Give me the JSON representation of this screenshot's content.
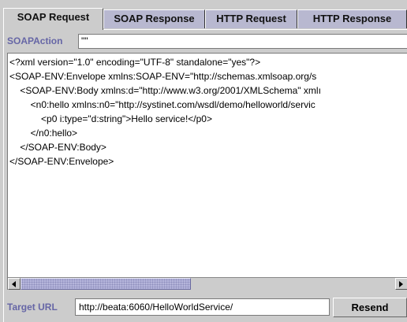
{
  "tabs": [
    {
      "label": "SOAP Request",
      "active": true
    },
    {
      "label": "SOAP Response",
      "active": false
    },
    {
      "label": "HTTP Request",
      "active": false
    },
    {
      "label": "HTTP Response",
      "active": false
    }
  ],
  "soap_action": {
    "label": "SOAPAction",
    "value": "\"\""
  },
  "editor": {
    "lines": [
      "<?xml version=\"1.0\" encoding=\"UTF-8\" standalone=\"yes\"?>",
      "<SOAP-ENV:Envelope xmlns:SOAP-ENV=\"http://schemas.xmlsoap.org/s",
      "    <SOAP-ENV:Body xmlns:d=\"http://www.w3.org/2001/XMLSchema\" xmlı",
      "        <n0:hello xmlns:n0=\"http://systinet.com/wsdl/demo/helloworld/servic",
      "            <p0 i:type=\"d:string\">Hello service!</p0>",
      "        </n0:hello>",
      "    </SOAP-ENV:Body>",
      "</SOAP-ENV:Envelope>"
    ]
  },
  "target_url": {
    "label": "Target URL",
    "value": "http://beata:6060/HelloWorldService/"
  },
  "resend_label": "Resend",
  "colors": {
    "label_accent": "#6666a6",
    "scroll_thumb": "#b5b5db",
    "inactive_tab": "#b8b8d0"
  }
}
